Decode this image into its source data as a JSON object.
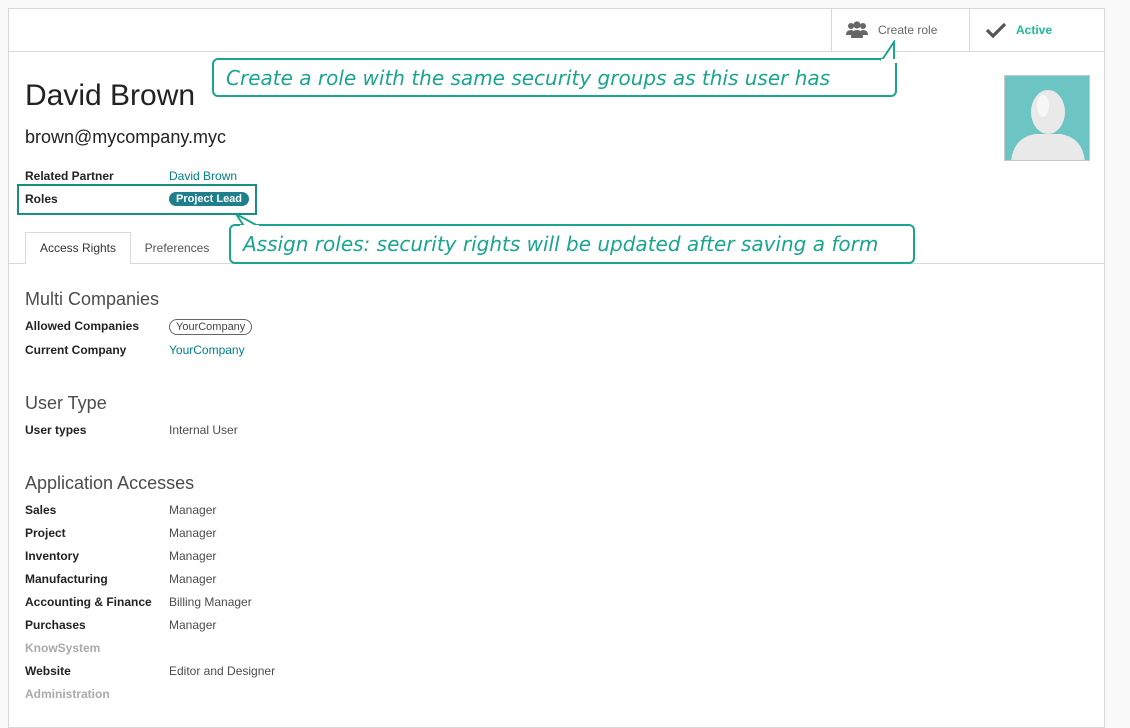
{
  "buttons": {
    "create_role": "Create role",
    "active": "Active"
  },
  "user": {
    "name": "David Brown",
    "email": "brown@mycompany.myc"
  },
  "fields": {
    "related_partner": {
      "label": "Related Partner",
      "value": "David Brown"
    },
    "roles": {
      "label": "Roles",
      "tag": "Project Lead"
    }
  },
  "tabs": [
    {
      "label": "Access Rights",
      "active": true
    },
    {
      "label": "Preferences",
      "active": false
    }
  ],
  "callouts": {
    "create_role": "Create a role with the same security groups as this user has",
    "assign_roles": "Assign roles: security rights will be updated after saving a form"
  },
  "sections": {
    "multi_companies": {
      "title": "Multi Companies",
      "allowed_companies": {
        "label": "Allowed Companies",
        "tag": "YourCompany"
      },
      "current_company": {
        "label": "Current Company",
        "value": "YourCompany"
      }
    },
    "user_type": {
      "title": "User Type",
      "user_types": {
        "label": "User types",
        "value": "Internal User"
      }
    },
    "application_accesses": {
      "title": "Application Accesses",
      "rows": [
        {
          "label": "Sales",
          "value": "Manager"
        },
        {
          "label": "Project",
          "value": "Manager"
        },
        {
          "label": "Inventory",
          "value": "Manager"
        },
        {
          "label": "Manufacturing",
          "value": "Manager"
        },
        {
          "label": "Accounting & Finance",
          "value": "Billing Manager"
        },
        {
          "label": "Purchases",
          "value": "Manager"
        },
        {
          "label": "KnowSystem",
          "value": ""
        },
        {
          "label": "Website",
          "value": "Editor and Designer"
        },
        {
          "label": "Administration",
          "value": ""
        }
      ]
    }
  },
  "colors": {
    "accent": "#21b799",
    "callout": "#1aa58f",
    "link": "#00808a",
    "role_tag": "#1f7f8c",
    "avatar_bg": "#6cc5c3"
  },
  "icons": {
    "create_role": "users-icon",
    "active": "check-icon",
    "avatar": "user-silhouette-icon"
  }
}
